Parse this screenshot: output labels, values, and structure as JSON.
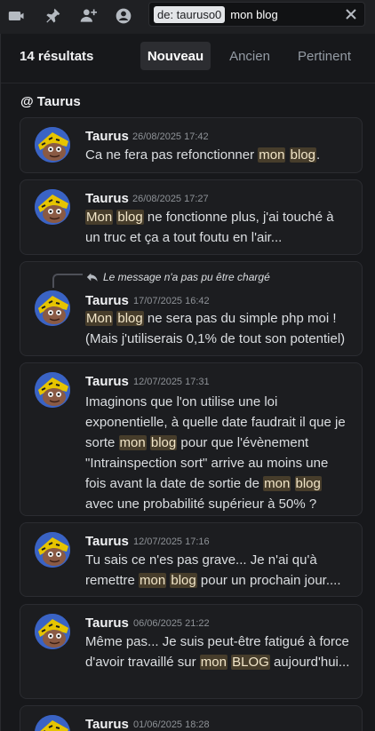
{
  "toolbar": {
    "icons": [
      "video-icon",
      "pin-icon",
      "add-user-icon",
      "profile-icon"
    ]
  },
  "search": {
    "filter_chip": "de: tauruso0",
    "query": "mon blog"
  },
  "results": {
    "count_label": "14 résultats",
    "tabs": [
      "Nouveau",
      "Ancien",
      "Pertinent"
    ],
    "active_tab": "Nouveau",
    "channel": "@ Taurus"
  },
  "messages": [
    {
      "author": "Taurus",
      "timestamp": "26/08/2025 17:42",
      "segments": [
        {
          "t": "Ca ne fera pas refonctionner "
        },
        {
          "t": "mon",
          "h": true
        },
        {
          "t": " "
        },
        {
          "t": "blog",
          "h": true
        },
        {
          "t": "."
        }
      ]
    },
    {
      "author": "Taurus",
      "timestamp": "26/08/2025 17:27",
      "segments": [
        {
          "t": "Mon",
          "h": true
        },
        {
          "t": " "
        },
        {
          "t": "blog",
          "h": true
        },
        {
          "t": " ne fonctionne plus, j'ai touché à un truc et ça a tout foutu en l'air..."
        }
      ]
    },
    {
      "reply_text": "Le message n'a pas pu être chargé",
      "author": "Taurus",
      "timestamp": "17/07/2025 16:42",
      "segments": [
        {
          "t": "Mon",
          "h": true
        },
        {
          "t": " "
        },
        {
          "t": "blog",
          "h": true
        },
        {
          "t": " ne sera pas du simple php moi ! (Mais j'utiliserais 0,1% de tout son potentiel)"
        }
      ]
    },
    {
      "author": "Taurus",
      "timestamp": "12/07/2025 17:31",
      "segments": [
        {
          "t": "Imaginons que l'on utilise une loi exponentielle, à quelle date faudrait il que je sorte "
        },
        {
          "t": "mon",
          "h": true
        },
        {
          "t": " "
        },
        {
          "t": "blog",
          "h": true
        },
        {
          "t": " pour que l'évènement \"Intrainspection sort\" arrive au moins une fois avant la date de sortie de "
        },
        {
          "t": "mon",
          "h": true
        },
        {
          "t": " "
        },
        {
          "t": "blog",
          "h": true
        },
        {
          "t": " avec une probabilité supérieur à 50% ?"
        }
      ]
    },
    {
      "author": "Taurus",
      "timestamp": "12/07/2025 17:16",
      "segments": [
        {
          "t": "Tu sais ce n'es pas grave... Je n'ai qu'à remettre "
        },
        {
          "t": "mon",
          "h": true
        },
        {
          "t": " "
        },
        {
          "t": "blog",
          "h": true
        },
        {
          "t": " pour un prochain jour...."
        }
      ]
    },
    {
      "author": "Taurus",
      "timestamp": "06/06/2025 21:22",
      "segments": [
        {
          "t": "Même pas... Je suis peut-être fatigué à force d'avoir travaillé sur "
        },
        {
          "t": "mon",
          "h": true
        },
        {
          "t": " "
        },
        {
          "t": "BLOG",
          "h": true
        },
        {
          "t": " aujourd'hui..."
        }
      ]
    },
    {
      "author": "Taurus",
      "timestamp": "01/06/2025 18:28",
      "segments": []
    }
  ]
}
